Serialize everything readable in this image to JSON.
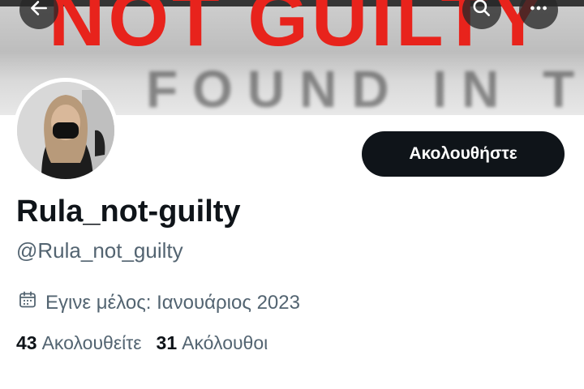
{
  "banner": {
    "headline": "NOT GUILTY",
    "subtext": "FOUND IN THE"
  },
  "icons": {
    "back": "arrow-left-icon",
    "search": "search-icon",
    "more": "more-horizontal-icon",
    "calendar": "calendar-icon"
  },
  "profile": {
    "follow_label": "Ακολουθήστε",
    "display_name": "Rula_not-guilty",
    "handle": "@Rula_not_guilty",
    "joined": "Εγινε μέλος: Ιανουάριος 2023",
    "following_count": "43",
    "following_label": "Ακολουθείτε",
    "followers_count": "31",
    "followers_label": "Ακόλουθοι"
  },
  "colors": {
    "headline": "#e8231c",
    "button_bg": "#0f1419",
    "secondary_text": "#536471"
  }
}
